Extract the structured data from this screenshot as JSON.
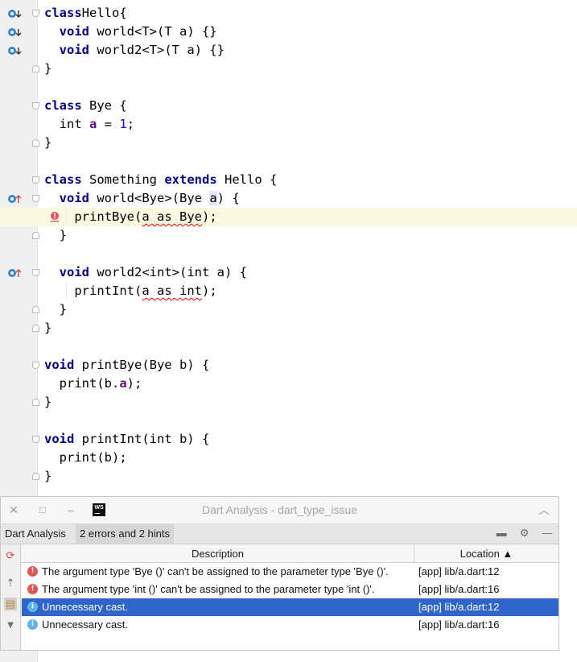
{
  "editor": {
    "lines": [
      {
        "tokens": [
          [
            "kw",
            "class"
          ],
          [
            "",
            "Hello{"
          ]
        ]
      },
      {
        "tokens": [
          [
            "",
            "  "
          ],
          [
            "kw",
            "void"
          ],
          [
            "",
            " world<T>(T a) {}"
          ]
        ]
      },
      {
        "tokens": [
          [
            "",
            "  "
          ],
          [
            "kw",
            "void"
          ],
          [
            "",
            " world2<T>(T a) {}"
          ]
        ]
      },
      {
        "tokens": [
          [
            "",
            "}"
          ]
        ]
      },
      {
        "tokens": []
      },
      {
        "tokens": [
          [
            "kw",
            "class"
          ],
          [
            "",
            " Bye {"
          ]
        ]
      },
      {
        "tokens": [
          [
            "",
            "  int "
          ],
          [
            "fld",
            "a"
          ],
          [
            "",
            " = "
          ],
          [
            "num",
            "1"
          ],
          [
            "",
            ";"
          ]
        ]
      },
      {
        "tokens": [
          [
            "",
            "}"
          ]
        ]
      },
      {
        "tokens": []
      },
      {
        "tokens": [
          [
            "kw",
            "class"
          ],
          [
            "",
            " Something "
          ],
          [
            "kw",
            "extends"
          ],
          [
            "",
            " Hello {"
          ]
        ]
      },
      {
        "tokens": [
          [
            "",
            "  "
          ],
          [
            "kw",
            "void"
          ],
          [
            "",
            " world<Bye>(Bye "
          ],
          [
            "caret",
            "a"
          ],
          [
            "",
            ") {"
          ]
        ]
      },
      {
        "tokens": [
          [
            "",
            "    printBye("
          ],
          [
            "wavy",
            "a as Bye"
          ],
          [
            "",
            ");"
          ]
        ]
      },
      {
        "tokens": [
          [
            "",
            "  }"
          ]
        ]
      },
      {
        "tokens": []
      },
      {
        "tokens": [
          [
            "",
            "  "
          ],
          [
            "kw",
            "void"
          ],
          [
            "",
            " world2<int>(int a) {"
          ]
        ]
      },
      {
        "tokens": [
          [
            "",
            "    printInt("
          ],
          [
            "wavy",
            "a as int"
          ],
          [
            "",
            ");"
          ]
        ]
      },
      {
        "tokens": [
          [
            "",
            "  }"
          ]
        ]
      },
      {
        "tokens": [
          [
            "",
            "}"
          ]
        ]
      },
      {
        "tokens": []
      },
      {
        "tokens": [
          [
            "kw",
            "void"
          ],
          [
            "",
            " printBye(Bye b) {"
          ]
        ]
      },
      {
        "tokens": [
          [
            "",
            "  print(b."
          ],
          [
            "fld",
            "a"
          ],
          [
            "",
            ");"
          ]
        ]
      },
      {
        "tokens": [
          [
            "",
            "}"
          ]
        ]
      },
      {
        "tokens": []
      },
      {
        "tokens": [
          [
            "kw",
            "void"
          ],
          [
            "",
            " printInt(int b) {"
          ]
        ]
      },
      {
        "tokens": [
          [
            "",
            "  print(b);"
          ]
        ]
      },
      {
        "tokens": [
          [
            "",
            "}"
          ]
        ]
      }
    ]
  },
  "tool_window": {
    "title": "Dart Analysis - dart_type_issue",
    "tabs": [
      {
        "label": "Dart Analysis"
      },
      {
        "label": "2 errors and 2 hints"
      }
    ],
    "columns": {
      "description": "Description",
      "location": "Location ▲"
    },
    "rows": [
      {
        "severity": "error",
        "description": "The argument type 'Bye ()' can't be assigned to the parameter type 'Bye ()'.",
        "location": "[app] lib/a.dart:12"
      },
      {
        "severity": "error",
        "description": "The argument type 'int ()' can't be assigned to the parameter type 'int ()'.",
        "location": "[app] lib/a.dart:16"
      },
      {
        "severity": "hint",
        "description": "Unnecessary cast.",
        "location": "[app] lib/a.dart:12"
      },
      {
        "severity": "hint",
        "description": "Unnecessary cast.",
        "location": "[app] lib/a.dart:16"
      }
    ]
  },
  "colors": {
    "selection": "#2f65ca",
    "error": "#e05555",
    "hint": "#5fb4e6",
    "keyword": "#000080",
    "field": "#660e7a",
    "number": "#0000ff"
  }
}
